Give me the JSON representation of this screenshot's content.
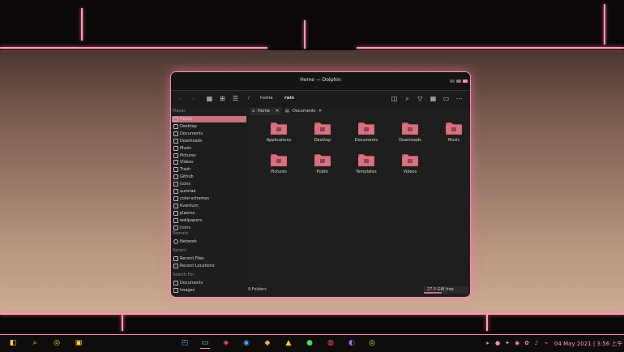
{
  "window": {
    "title": "Home — Dolphin",
    "breadcrumb": [
      "/",
      "home",
      "rain"
    ]
  },
  "sidebar": {
    "places_header": "Places",
    "places": [
      "Home",
      "Desktop",
      "Documents",
      "Downloads",
      "Music",
      "Pictures",
      "Videos",
      "Trash",
      "Github",
      "icons",
      "aurorae",
      "color-schemes",
      "Kvantum",
      "plasma",
      "wallpapers",
      "icons"
    ],
    "remote_header": "Remote",
    "remote": [
      "Network"
    ],
    "recent_header": "Recent",
    "recent": [
      "Recent Files",
      "Recent Locations"
    ],
    "search_header": "Search For",
    "search": [
      "Documents",
      "Images"
    ]
  },
  "tabs": [
    "Home",
    "Documents"
  ],
  "files": [
    "Applications",
    "Desktop",
    "Documents",
    "Downloads",
    "Music",
    "Pictures",
    "Public",
    "Templates",
    "Videos"
  ],
  "status": {
    "count": "9 Folders",
    "free": "27.5 GiB free",
    "free_fraction": 0.4
  },
  "taskbar": {
    "clock": "04 May 2021 | 3:56 上午"
  },
  "colors": {
    "accent": "#ff8fae",
    "selection": "#c9707d",
    "folder": "#d9707f"
  }
}
